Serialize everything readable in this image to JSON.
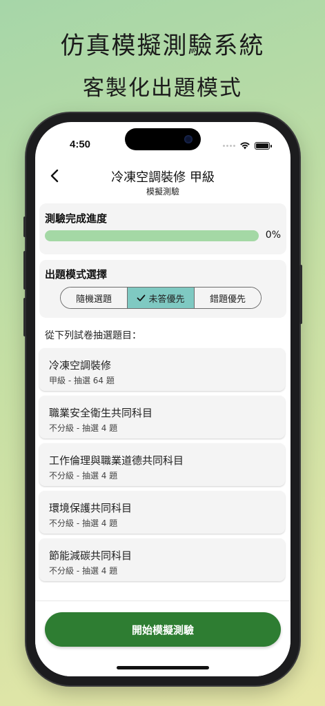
{
  "marketing": {
    "headline": "仿真模擬測驗系統",
    "subheadline": "客製化出題模式"
  },
  "status_bar": {
    "time": "4:50"
  },
  "nav": {
    "title": "冷凍空調裝修 甲級",
    "subtitle": "模擬測驗"
  },
  "progress": {
    "heading": "測驗完成進度",
    "percent_text": "0%",
    "value": 0
  },
  "mode": {
    "heading": "出題模式選擇",
    "options": [
      "隨機選題",
      "未答優先",
      "錯題優先"
    ],
    "selected": "未答優先"
  },
  "section_label": "從下列試卷抽選題目：",
  "subjects": [
    {
      "name": "冷凍空調裝修",
      "meta": "甲級 - 抽選 64 題"
    },
    {
      "name": "職業安全衛生共同科目",
      "meta": "不分級 - 抽選 4 題"
    },
    {
      "name": "工作倫理與職業道德共同科目",
      "meta": "不分級 - 抽選 4 題"
    },
    {
      "name": "環境保護共同科目",
      "meta": "不分級 - 抽選 4 題"
    },
    {
      "name": "節能減碳共同科目",
      "meta": "不分級 - 抽選 4 題"
    }
  ],
  "start_button": "開始模擬測驗",
  "colors": {
    "primary_green": "#2e7d32",
    "progress_track": "#a4d8a5",
    "selected_segment": "#7fc9c2"
  }
}
